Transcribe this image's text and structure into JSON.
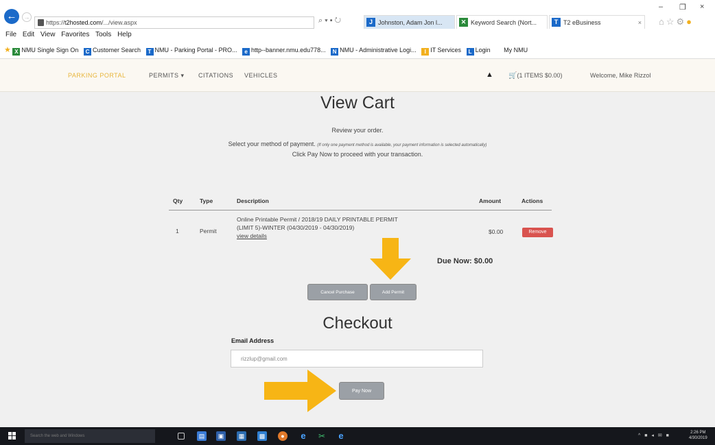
{
  "browser": {
    "url_prefix": "https://",
    "url_host": "t2hosted.com",
    "url_path": "/.../view.aspx",
    "tabs": [
      {
        "label": "Johnston, Adam Jon l...",
        "icon_color": "#1b6ac9",
        "icon_glyph": "J"
      },
      {
        "label": "Keyword Search (Nort...",
        "icon_color": "#2a8a3a",
        "icon_glyph": "✕"
      },
      {
        "label": "T2 eBusiness",
        "icon_color": "#1b6ac9",
        "icon_glyph": "T"
      }
    ],
    "menu": [
      "File",
      "Edit",
      "View",
      "Favorites",
      "Tools",
      "Help"
    ],
    "favorites": [
      {
        "label": "NMU Single Sign On",
        "icon": "X",
        "icon_color": "#2a8a3a"
      },
      {
        "label": "Customer Search",
        "icon": "C",
        "icon_color": "#1b6ac9"
      },
      {
        "label": "NMU - Parking Portal - PRO...",
        "icon": "T",
        "icon_color": "#1b6ac9"
      },
      {
        "label": "http--banner.nmu.edu778...",
        "icon": "e",
        "icon_color": "#1b6ac9"
      },
      {
        "label": "NMU - Administrative Logi...",
        "icon": "N",
        "icon_color": "#1b6ac9"
      },
      {
        "label": "IT Services",
        "icon": "I",
        "icon_color": "#f2b01e"
      },
      {
        "label": "Login",
        "icon": "L",
        "icon_color": "#1b6ac9"
      },
      {
        "label": "My NMU",
        "icon": "",
        "icon_color": "#ffffff"
      }
    ]
  },
  "nav": {
    "brand": "PARKING PORTAL",
    "permits": "PERMITS ▾",
    "citations": "CITATIONS",
    "vehicles": "VEHICLES",
    "cart": "(1 ITEMS $0.00)",
    "welcome": "Welcome, Mike Rizzol"
  },
  "page": {
    "title": "View Cart",
    "review": "Review your order.",
    "method": "Select your method of payment.",
    "method_note": "(If only one payment method is available, your payment information is selected automatically)",
    "pay_hint": "Click Pay Now to proceed with your transaction."
  },
  "cart": {
    "headers": {
      "qty": "Qty",
      "type": "Type",
      "description": "Description",
      "amount": "Amount",
      "actions": "Actions"
    },
    "rows": [
      {
        "qty": "1",
        "type": "Permit",
        "desc_line1": "Online Printable Permit / 2018/19 DAILY PRINTABLE PERMIT",
        "desc_line2": "(LIMIT 5)-WINTER (04/30/2019 - 04/30/2019)",
        "details": "view details",
        "amount": "$0.00",
        "action": "Remove"
      }
    ],
    "due": "Due Now: $0.00",
    "cancel": "Cancel Purchase",
    "add": "Add Permit"
  },
  "checkout": {
    "title": "Checkout",
    "email_label": "Email Address",
    "email_value": "rizzlup@gmail.com",
    "pay_button": "Pay Now"
  },
  "taskbar": {
    "search_placeholder": "Search the web and Windows",
    "time": "2:26 PM",
    "date": "4/30/2019"
  },
  "colors": {
    "arrow": "#f7b515",
    "brand": "#e8b53a",
    "remove": "#d9534f",
    "button_gray": "#9ba0a6"
  }
}
